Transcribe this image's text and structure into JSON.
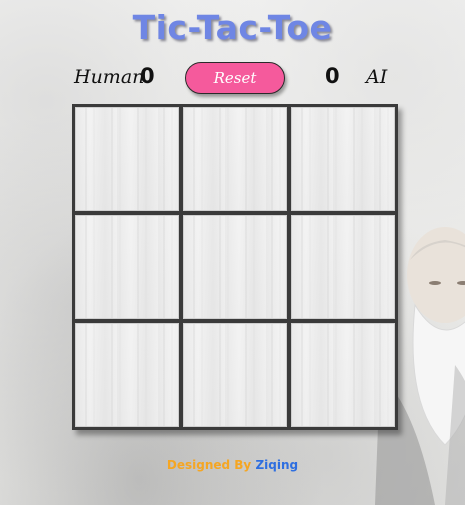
{
  "app": {
    "title": "Tic-Tac-Toe"
  },
  "scoreboard": {
    "human_label": "Human",
    "human_score": "0",
    "ai_score": "0",
    "ai_label": "AI",
    "reset_label": "Reset"
  },
  "board": {
    "cells": [
      "",
      "",
      "",
      "",
      "",
      "",
      "",
      "",
      ""
    ]
  },
  "footer": {
    "prefix": "Designed By",
    "author": "Ziqing"
  },
  "colors": {
    "title": "#6f86e4",
    "reset_button": "#f55a9c",
    "footer_prefix": "#f5a623",
    "footer_author": "#2f6fe0",
    "board_lines": "#3a3a3a"
  }
}
